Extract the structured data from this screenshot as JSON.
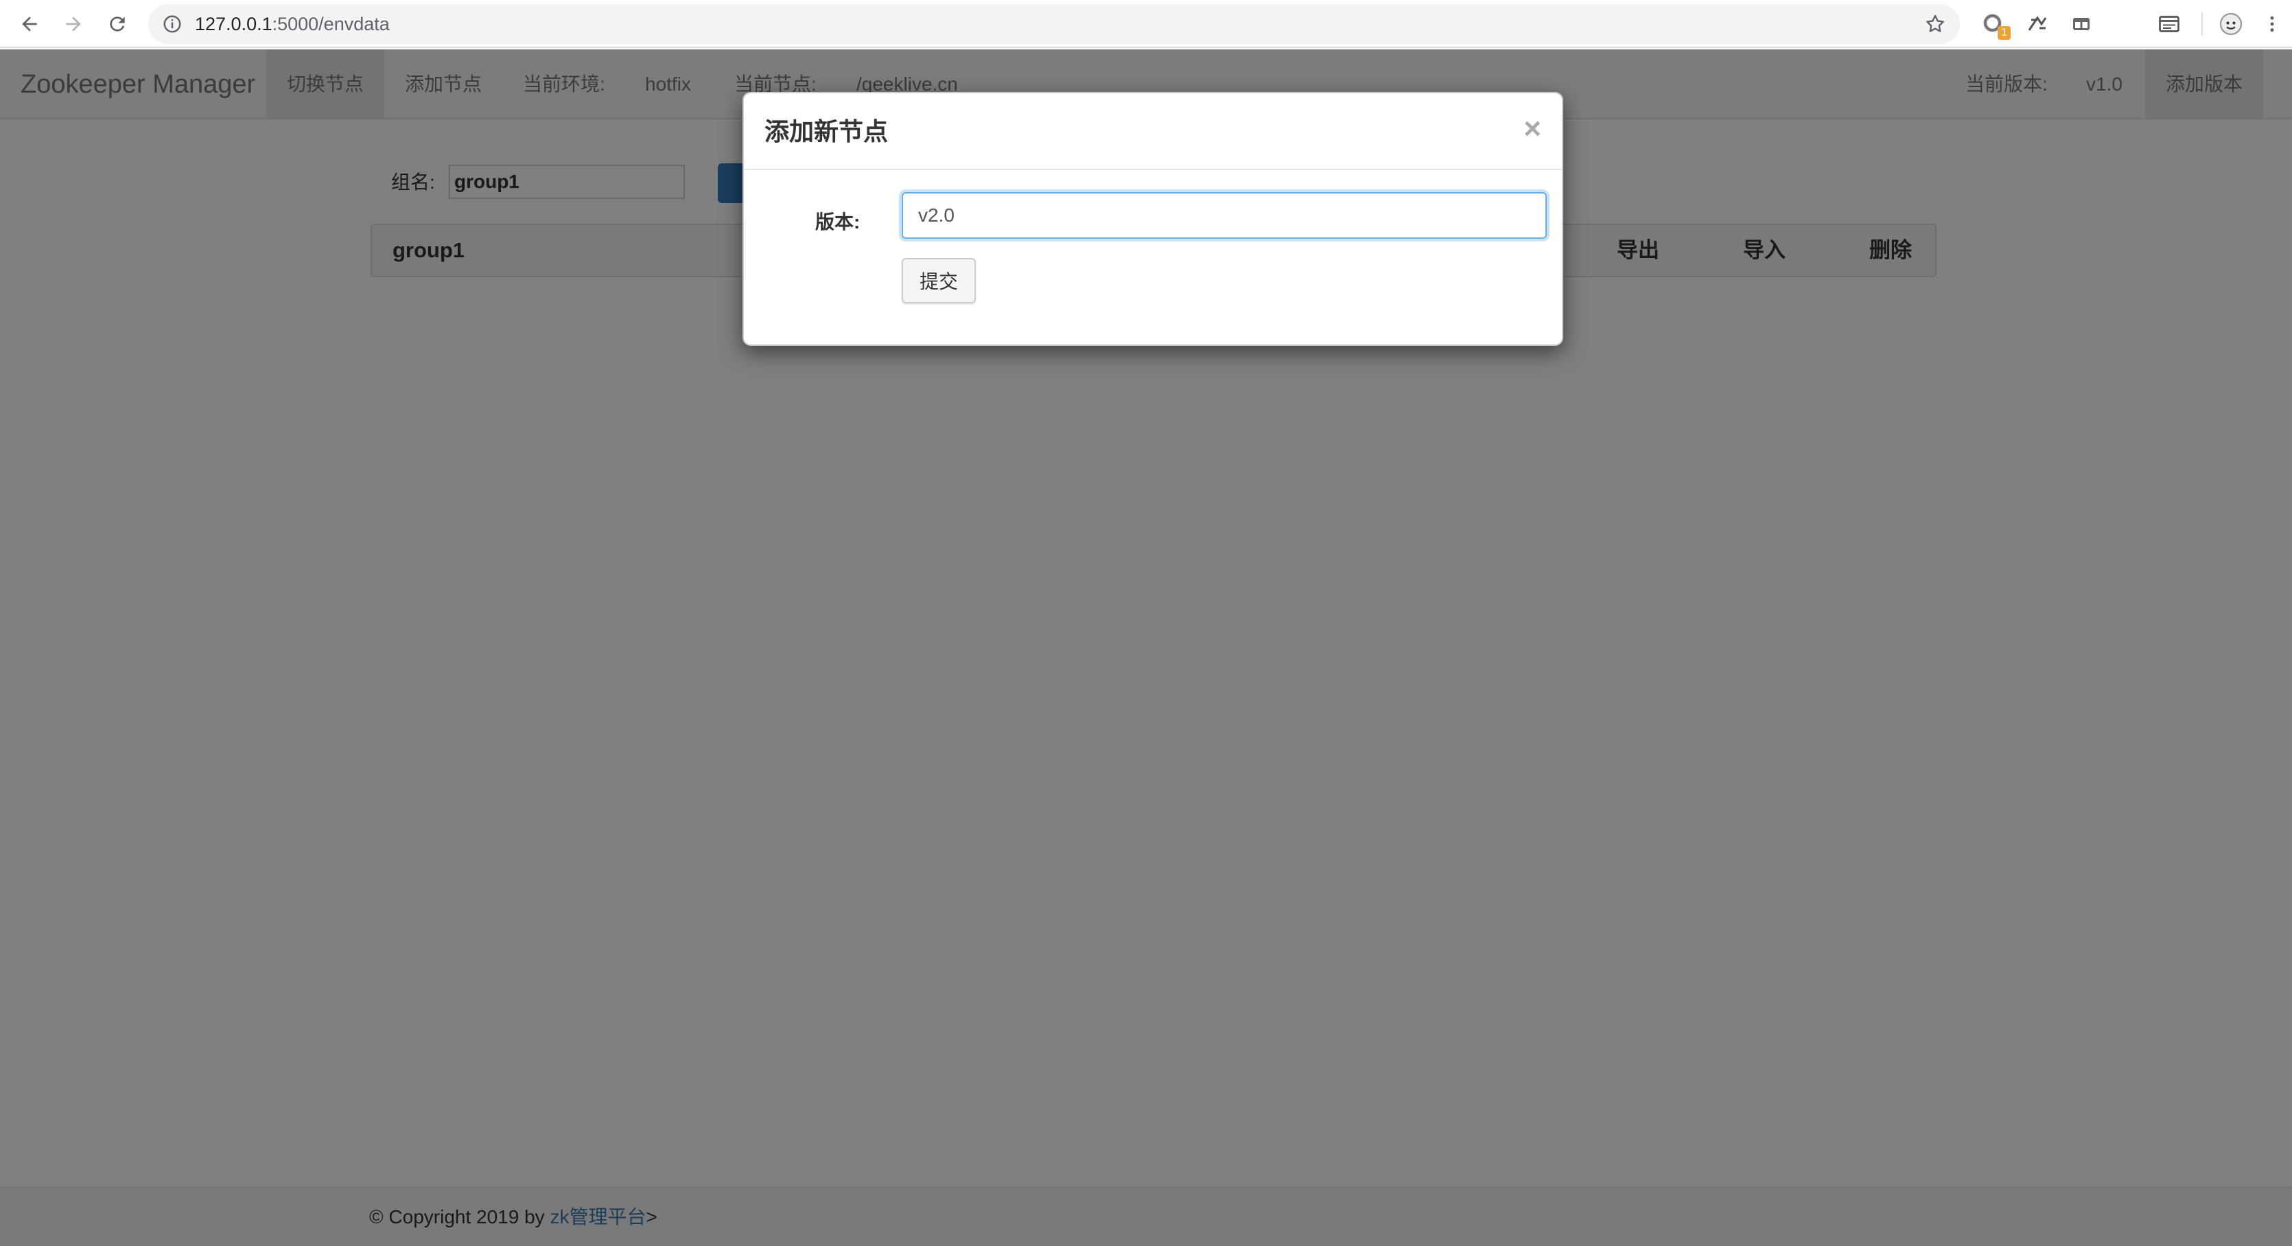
{
  "browser": {
    "url_host": "127.0.0.1",
    "url_path": ":5000/envdata",
    "extension_badge": "1"
  },
  "navbar": {
    "brand": "Zookeeper Manager",
    "switch_node": "切换节点",
    "add_node": "添加节点",
    "current_env_label": "当前环境:",
    "current_env_value": "hotfix",
    "current_node_label": "当前节点:",
    "current_node_value": "/geeklive.cn",
    "current_version_label": "当前版本:",
    "current_version_value": "v1.0",
    "add_version": "添加版本"
  },
  "group_form": {
    "label": "组名:",
    "value": "group1"
  },
  "panel": {
    "title": "group1",
    "actions": [
      "导出",
      "导入",
      "删除"
    ]
  },
  "footer": {
    "prefix": "© Copyright 2019 by ",
    "link": "zk管理平台",
    "suffix": ">"
  },
  "modal": {
    "title": "添加新节点",
    "close": "×",
    "version_label": "版本:",
    "version_value": "v2.0",
    "submit": "提交"
  },
  "colors": {
    "primary": "#337ab7",
    "focus_border": "#66afe9",
    "backdrop": "rgba(0,0,0,0.5)"
  }
}
